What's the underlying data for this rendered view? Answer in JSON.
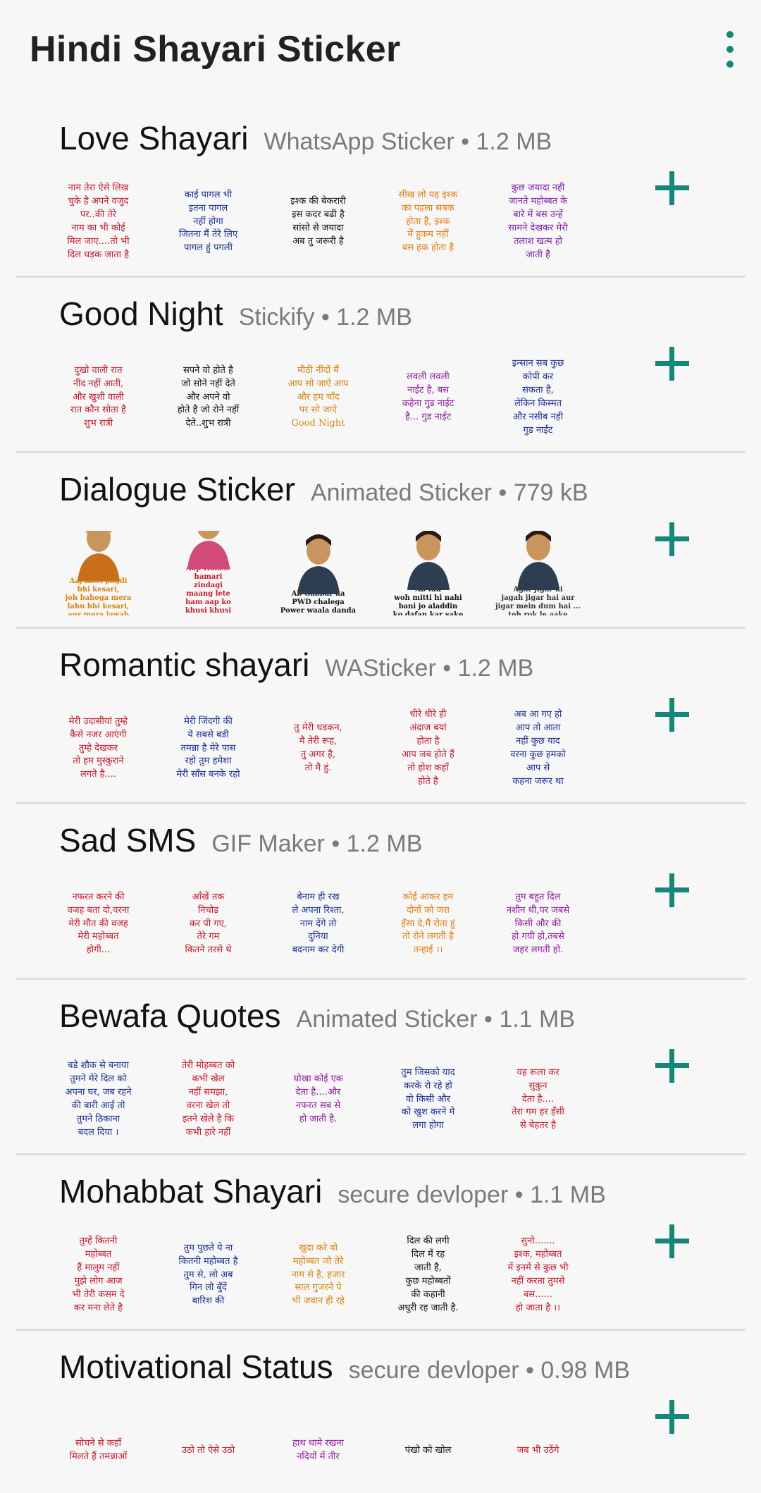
{
  "app": {
    "title": "Hindi Shayari Sticker"
  },
  "colors": {
    "accent": "#16857a"
  },
  "packs": [
    {
      "name": "Love Shayari",
      "meta": "WhatsApp Sticker • 1.2 MB",
      "stickers": [
        {
          "text": "नाम तेरा ऐसे लिख\nचुके है अपने वजुद\nपर..की तेरे\nनाम का भी कोई\nमिल जाए....तो भी\nदिल धड़क जाता है",
          "color": "#c0182a"
        },
        {
          "text": "काई पागल भी\nइतना पागल\nनहीं होगा\nजितना मैं तेरे लिए\nपागल हुं पगली",
          "color": "#17318c"
        },
        {
          "text": "इश्क की बेकरारी\nइस कदर बढी है\nसांसो से जयादा\nअब तु जरूरी है",
          "color": "#111111"
        },
        {
          "text": "सीख लो यह इश्क\nका पहला सबक\nहोता है, इश्क\nमें हुकम नहीं\nबस हक होता है",
          "color": "#e07b12"
        },
        {
          "text": "कुछ जयादा नही\nजानते महोब्बत के\nबारे में बस उन्हें\nसामने देखकर मेरी\nतलाश खत्म हो\nजाती है",
          "color": "#7b1fa2"
        }
      ]
    },
    {
      "name": "Good Night",
      "meta": "Stickify • 1.2 MB",
      "stickers": [
        {
          "text": "दुखो वाली रात\nनींद नहीं आती,\nऔर खुशी वाली\nरात कौन सोता है\nशुभ रात्री",
          "color": "#c0182a"
        },
        {
          "text": "सपने वो होते है\nजो सोने नहीं देते\nऔर अपने वो\nहोते है जो रोने नहीं\nदेते..शुभ रात्री",
          "color": "#111111"
        },
        {
          "text": "मीठी नींदों मैं\nआप सो जाऐ आप\nऔर हम चाँद\nपर सो जाऐ\nGood Night",
          "color": "#d4830f"
        },
        {
          "text": "लवली लवली\nनाईट है, बस\nकहेना गुड नाईट\nहै... गुड नाईट",
          "color": "#8e1a9c"
        },
        {
          "text": "इन्सान सब कुछ\nकोपी कर\nसकता है,\nलेकिन किस्मत\nऔर नसीब नही\nगुड नाईट",
          "color": "#1a2c8c"
        }
      ]
    },
    {
      "name": "Dialogue Sticker",
      "meta": "Animated Sticker • 779 kB",
      "stickers": [
        {
          "text": "Aaj meri pagdi\nbhi kesari,\njoh bahega mera\nlahu bhi kesari,\naur mera jawab\nbhi kesari",
          "color": "#d4830f"
        },
        {
          "text": "Aap Hamse\nhamari\nzindagi\nmaang lete\nham aap ko\nkhusi khusi\nde dete par apne\nto humse humara\nguroor chheen liya",
          "color": "#c0182a"
        },
        {
          "text": "Ab Gabbar ka\nPWD chalega\nPower waala danda",
          "color": "#111111"
        },
        {
          "text": "Ab tak\nwoh mitti hi nahi\nbani jo aladdin\nko dafan kar sake",
          "color": "#111111"
        },
        {
          "text": "Agar jigar ki\njagah jigar hai aur\njigar mein dum hai ...\ntoh rok le aake",
          "color": "#333333"
        }
      ]
    },
    {
      "name": "Romantic shayari",
      "meta": "WASticker • 1.2 MB",
      "stickers": [
        {
          "text": "मेरी उदासीयां तुम्हे\nकैसे नजर आएंगी\nतुम्हे देखकर\nतो हम मुस्कुराने\nलगते है....",
          "color": "#c0182a"
        },
        {
          "text": "मेरी जिंदगी की\nये सबसे बडी\nतमन्ना है मेरे पास\nरहो तुम हमेशा\nमेरी साँस बनके रहो",
          "color": "#17318c"
        },
        {
          "text": "तु मेरी धडकन,\nमै तेरी रूह,\nतु अगर है,\nतो मै हुं.",
          "color": "#c0182a"
        },
        {
          "text": "धीरे धीरे ही\nअंदाज बयां\nहोता है\nआप जब होते हैं\nतो होश कहाँ\nहोते है",
          "color": "#c0182a"
        },
        {
          "text": "अब आ गए हो\nआप तो आता\nनहीं कुछ याद\nवरना कुछ हमको\nआप से\nकहना जरूर था",
          "color": "#1a2c8c"
        }
      ]
    },
    {
      "name": "Sad SMS",
      "meta": "GIF Maker • 1.2 MB",
      "stickers": [
        {
          "text": "नफरत करने की\nवजह बता दो,वरना\nमेरी मौत की वजह\nमेरी महोब्बत\nहोगी...",
          "color": "#c0182a"
        },
        {
          "text": "आँखें तक\nनिचोड\nकर पी गए,\nतेरे गम\nकितने तरसे थे",
          "color": "#c0182a"
        },
        {
          "text": "बेनाम ही रख\nले अपना रिश्ता,\nनाम देंगे तो\nदुनिया\nबदनाम कर देगी",
          "color": "#17318c"
        },
        {
          "text": "कोई आकर हम\nदोनों को जरा\nहँसा दे,मैं रोता हुं\nतो रोने लगती है\nतन्हाई ।।",
          "color": "#e07b12"
        },
        {
          "text": "तुम बहुत दिल\nनशीन थी,पर जबसे\nकिसी और की\nहो गयी हो,तबसे\nजहर लगती हो.",
          "color": "#8e1a9c"
        }
      ]
    },
    {
      "name": "Bewafa Quotes",
      "meta": "Animated Sticker • 1.1 MB",
      "stickers": [
        {
          "text": "बडे शौक से बनाया\nतुमने मेरे दिल को\nअपना घर, जब रहने\nकी बारी आई तो\nतुमने ठिकाना\nबदल दिया ।",
          "color": "#17318c"
        },
        {
          "text": "तेरी मोहब्बत को\nकभी खेल\nनहीं समझा,\nवरना खेल तो\nइतने खेले है कि\nकभी हारे नहीं",
          "color": "#c0182a"
        },
        {
          "text": "धोखा कोई एक\nदेता है....और\nनफरत सब से\nहो जाती है.",
          "color": "#8e1a9c"
        },
        {
          "text": "तुम जिसको याद\nकरके रो रहे हो\nवो किसी और\nको खुश करने मे\nलगा होगा",
          "color": "#1a2c8c"
        },
        {
          "text": "यह रूला कर\nसुकुन\nदेता है....\nतेरा गम हर हँसी\nसे बेहतर है",
          "color": "#c0182a"
        }
      ]
    },
    {
      "name": "Mohabbat Shayari",
      "meta": "secure devloper • 1.1 MB",
      "stickers": [
        {
          "text": "तुम्हें कितनी\nमहोब्बत\nहैं मालुम नहीं\nमुझे लोग आज\nभी तेरी कसम दे\nकर मना लेते है",
          "color": "#c0182a"
        },
        {
          "text": "तुम पुछते ये ना\nकितनी महोब्बत है\nतुम से, लो अब\nगिन लो बुँदें\nबारिश की",
          "color": "#17318c"
        },
        {
          "text": "खुदा करे वो\nमहोब्बत जो तेरे\nनाम से है, हजार\nसाल गुजरने पे\nभी जवान ही रहे",
          "color": "#d4830f"
        },
        {
          "text": "दिल की लगी\nदिल में रह\nजाती है,\nकुछ महोब्बतों\nकी कहानी\nअधुरी रह जाती है.",
          "color": "#111111"
        },
        {
          "text": "सुनो.......\nइश्क, महोब्बत\nमें इनमें से कुछ भी\nनहीं करता तुमसे\nबस......\nहो जाता है ।।",
          "color": "#c0182a"
        }
      ]
    },
    {
      "name": "Motivational Status",
      "meta": "secure devloper • 0.98 MB",
      "stickers": [
        {
          "text": "सोचने से कहाँ\nमिलते हैं तमन्नाओं",
          "color": "#c0182a"
        },
        {
          "text": "उठो तो ऐसे उठो",
          "color": "#c0182a"
        },
        {
          "text": "हाथ थामे रखना\nनदियों में तीर",
          "color": "#8e1a9c"
        },
        {
          "text": "पंखो को खोल",
          "color": "#111111"
        },
        {
          "text": "जब भी उठेंगे",
          "color": "#c0182a"
        }
      ]
    }
  ]
}
